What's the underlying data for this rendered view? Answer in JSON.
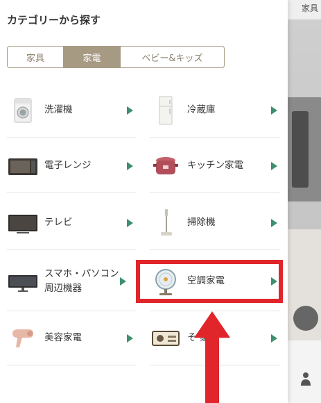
{
  "background": {
    "tab_label": "家具"
  },
  "header": {
    "title": "カテゴリーから探す"
  },
  "tabs": [
    {
      "label": "家具",
      "active": false
    },
    {
      "label": "家電",
      "active": true
    },
    {
      "label": "ベビー&キッズ",
      "active": false
    }
  ],
  "categories": [
    {
      "label": "洗濯機",
      "icon": "washing-machine-icon"
    },
    {
      "label": "冷蔵庫",
      "icon": "refrigerator-icon"
    },
    {
      "label": "電子レンジ",
      "icon": "microwave-icon"
    },
    {
      "label": "キッチン家電",
      "icon": "rice-cooker-icon"
    },
    {
      "label": "テレビ",
      "icon": "tv-icon"
    },
    {
      "label": "掃除機",
      "icon": "vacuum-icon"
    },
    {
      "label": "スマホ・パソコン周辺機器",
      "icon": "monitor-icon"
    },
    {
      "label": "空調家電",
      "icon": "fan-icon",
      "highlighted": true
    },
    {
      "label": "美容家電",
      "icon": "hair-dryer-icon"
    },
    {
      "label": "その他家電",
      "icon": "radio-icon",
      "visible_text": "そ   家電"
    }
  ],
  "colors": {
    "accent": "#a69a83",
    "arrow_green": "#3e8f6e",
    "highlight_red": "#e0262b"
  }
}
